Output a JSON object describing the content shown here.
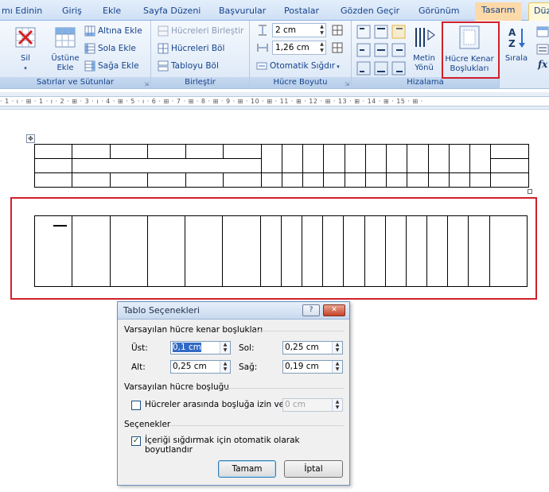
{
  "tabs": [
    {
      "label": "mı Edinin"
    },
    {
      "label": "Giriş"
    },
    {
      "label": "Ekle"
    },
    {
      "label": "Sayfa Düzeni"
    },
    {
      "label": "Başvurular"
    },
    {
      "label": "Postalar"
    },
    {
      "label": "Gözden Geçir"
    },
    {
      "label": "Görünüm"
    },
    {
      "label": "Tasarım"
    },
    {
      "label": "Düz"
    }
  ],
  "ribbon": {
    "rows_cols": {
      "delete_label": "Sil",
      "insert_above_label": "Üstüne Ekle",
      "insert_below_label": "Altına Ekle",
      "insert_left_label": "Sola Ekle",
      "insert_right_label": "Sağa Ekle",
      "group_label": "Satırlar ve Sütunlar"
    },
    "merge": {
      "merge_cells_label": "Hücreleri Birleştir",
      "split_cells_label": "Hücreleri Böl",
      "split_table_label": "Tabloyu Böl",
      "group_label": "Birleştir"
    },
    "cell_size": {
      "height_value": "2 cm",
      "width_value": "1,26 cm",
      "autofit_label": "Otomatik Sığdır",
      "group_label": "Hücre Boyutu"
    },
    "alignment": {
      "text_direction_label": "Metin Yönü",
      "cell_margins_label": "Hücre Kenar Boşlukları",
      "group_label": "Hizalama"
    },
    "data": {
      "sort_label": "Sırala"
    }
  },
  "ruler": {
    "marks": "· 1 · ı · ⊞ · 1 · ı · 2 · ⊞ · 3 · ı · 4 · ⊞ · 5 · ı · 6 · ⊞ · 7 · ⊞ · 8 · ⊞ · 9 · ⊞ · 10 · ⊞ · 11 · ⊞ · 12 · ⊞ · 13 · ⊞ · 14 · ⊞ · 15 · ⊞ ·"
  },
  "dialog": {
    "title": "Tablo Seçenekleri",
    "help_button": "?",
    "close_button": "✕",
    "default_margins_heading": "Varsayılan hücre kenar boşlukları",
    "top_label": "Üst:",
    "top_value": "0,1 cm",
    "bottom_label": "Alt:",
    "bottom_value": "0,25 cm",
    "left_label": "Sol:",
    "left_value": "0,25 cm",
    "right_label": "Sağ:",
    "right_value": "0,19 cm",
    "default_spacing_heading": "Varsayılan hücre boşluğu",
    "allow_spacing_label": "Hücreler arasında boşluğa izin ver",
    "allow_spacing_checked": false,
    "spacing_value": "0 cm",
    "options_heading": "Seçenekler",
    "autoresize_label": "İçeriği sığdırmak için otomatik olarak boyutlandır",
    "autoresize_checked": true,
    "ok_label": "Tamam",
    "cancel_label": "İptal"
  },
  "colors": {
    "highlight_red": "#d1202a",
    "ribbon_text": "#15428b"
  }
}
